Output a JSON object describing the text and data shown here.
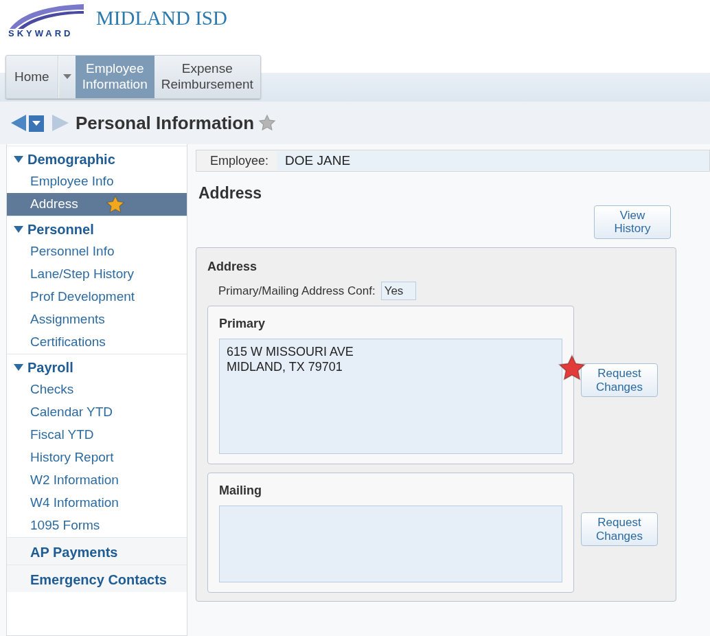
{
  "header": {
    "district": "MIDLAND ISD",
    "logo_text": "SKYWARD"
  },
  "tabs": [
    {
      "kind": "home",
      "label": "Home",
      "selected": false
    },
    {
      "kind": "menu",
      "label": "Employee Information",
      "selected": true
    },
    {
      "kind": "menu",
      "label": "Expense Reimbursement",
      "selected": false
    }
  ],
  "page_title": "Personal Information",
  "sidebar": {
    "groups": [
      {
        "label": "Demographic",
        "expanded": true,
        "items": [
          {
            "label": "Employee Info",
            "selected": false,
            "favorite": false
          },
          {
            "label": "Address",
            "selected": true,
            "favorite": true
          }
        ]
      },
      {
        "label": "Personnel",
        "expanded": true,
        "items": [
          {
            "label": "Personnel Info",
            "selected": false,
            "favorite": false
          },
          {
            "label": "Lane/Step History",
            "selected": false,
            "favorite": false
          },
          {
            "label": "Prof Development",
            "selected": false,
            "favorite": false
          },
          {
            "label": "Assignments",
            "selected": false,
            "favorite": false
          },
          {
            "label": "Certifications",
            "selected": false,
            "favorite": false
          }
        ]
      },
      {
        "label": "Payroll",
        "expanded": true,
        "items": [
          {
            "label": "Checks",
            "selected": false,
            "favorite": false
          },
          {
            "label": "Calendar YTD",
            "selected": false,
            "favorite": false
          },
          {
            "label": "Fiscal YTD",
            "selected": false,
            "favorite": false
          },
          {
            "label": "History Report",
            "selected": false,
            "favorite": false
          },
          {
            "label": "W2 Information",
            "selected": false,
            "favorite": false
          },
          {
            "label": "W4 Information",
            "selected": false,
            "favorite": false
          },
          {
            "label": "1095 Forms",
            "selected": false,
            "favorite": false
          }
        ]
      },
      {
        "label": "AP Payments",
        "expanded": false
      },
      {
        "label": "Emergency Contacts",
        "expanded": false
      }
    ]
  },
  "employee": {
    "label": "Employee:",
    "value": "DOE JANE"
  },
  "section_title": "Address",
  "view_history_button": "View History",
  "address_panel": {
    "title": "Address",
    "conf_label": "Primary/Mailing Address Conf:",
    "conf_value": "Yes",
    "blocks": [
      {
        "title": "Primary",
        "lines": [
          "615 W MISSOURI AVE",
          "MIDLAND, TX 79701"
        ],
        "button": "Request Changes",
        "flagged": true
      },
      {
        "title": "Mailing",
        "button": "Request Changes",
        "flagged": false
      }
    ]
  }
}
